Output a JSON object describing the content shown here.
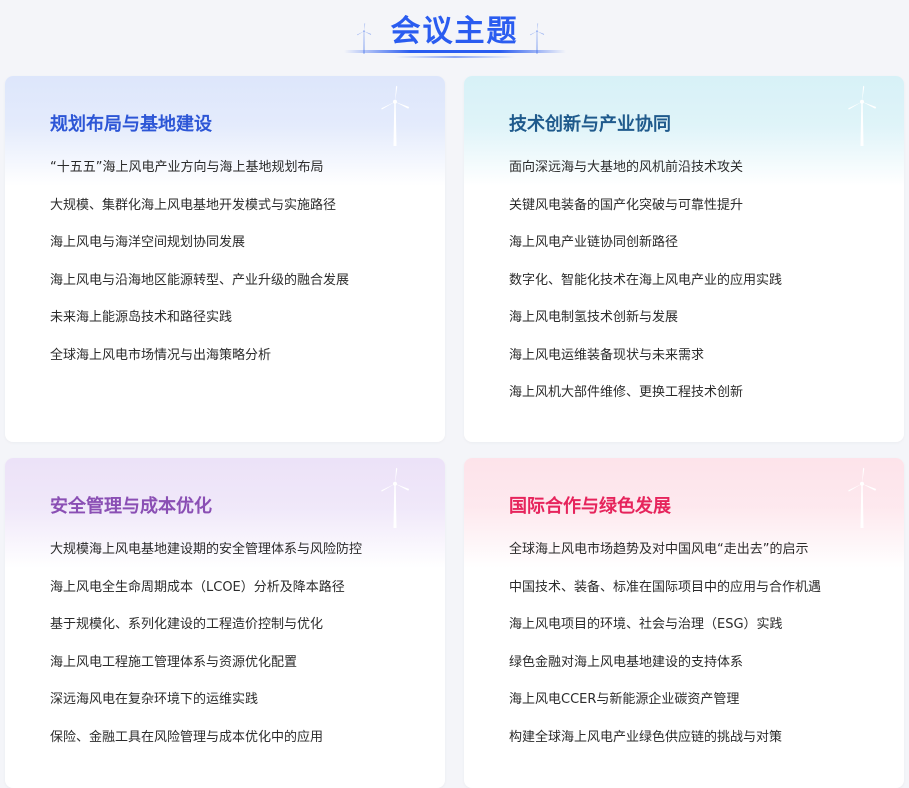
{
  "page_title": "会议主题",
  "cards": [
    {
      "title": "规划布局与基地建设",
      "title_color": "#2d56d6",
      "band_color": "#dde6fb",
      "items": [
        "“十五五”海上风电产业方向与海上基地规划布局",
        "大规模、集群化海上风电基地开发模式与实施路径",
        "海上风电与海洋空间规划协同发展",
        "海上风电与沿海地区能源转型、产业升级的融合发展",
        "未来海上能源岛技术和路径实践",
        "全球海上风电市场情况与出海策略分析"
      ]
    },
    {
      "title": "技术创新与产业协同",
      "title_color": "#1f5a8c",
      "band_color": "#d7f1f7",
      "items": [
        "面向深远海与大基地的风机前沿技术攻关",
        "关键风电装备的国产化突破与可靠性提升",
        "海上风电产业链协同创新路径",
        "数字化、智能化技术在海上风电产业的应用实践",
        "海上风电制氢技术创新与发展",
        "海上风电运维装备现状与未来需求",
        "海上风机大部件维修、更换工程技术创新"
      ]
    },
    {
      "title": "安全管理与成本优化",
      "title_color": "#8a4fb4",
      "band_color": "#ece2f8",
      "items": [
        "大规模海上风电基地建设期的安全管理体系与风险防控",
        "海上风电全生命周期成本（LCOE）分析及降本路径",
        "基于规模化、系列化建设的工程造价控制与优化",
        "海上风电工程施工管理体系与资源优化配置",
        "深远海风电在复杂环境下的运维实践",
        "保险、金融工具在风险管理与成本优化中的应用"
      ]
    },
    {
      "title": "国际合作与绿色发展",
      "title_color": "#e6245c",
      "band_color": "#fde3ea",
      "items": [
        "全球海上风电市场趋势及对中国风电“走出去”的启示",
        "中国技术、装备、标准在国际项目中的应用与合作机遇",
        "海上风电项目的环境、社会与治理（ESG）实践",
        "绿色金融对海上风电基地建设的支持体系",
        "海上风电CCER与新能源企业碳资产管理",
        "构建全球海上风电产业绿色供应链的挑战与对策"
      ]
    }
  ]
}
